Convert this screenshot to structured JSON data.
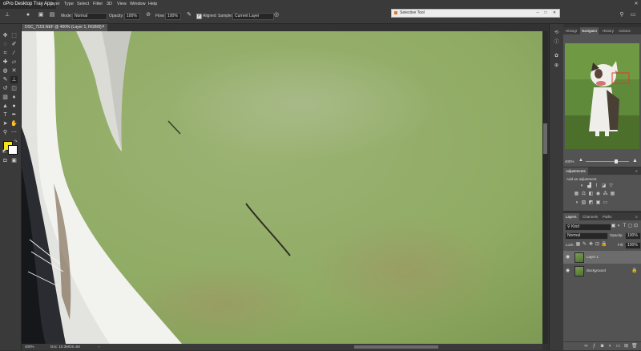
{
  "menubar": {
    "tray_title": "oPro Desktop Tray App",
    "items": [
      "ayer",
      "Type",
      "Select",
      "Filter",
      "3D",
      "View",
      "Window",
      "Help"
    ]
  },
  "options": {
    "mode_label": "Mode:",
    "mode_value": "Normal",
    "opacity_label": "Opacity:",
    "opacity_value": "100%",
    "flow_label": "Flow:",
    "flow_value": "100%",
    "aligned_label": "Aligned",
    "sample_label": "Sample:",
    "sample_value": "Current Layer"
  },
  "selective_tool": {
    "title": "Selective Tool"
  },
  "document": {
    "tab_title": "DSC_7153.NEF @ 400% (Layer 1, RGB/8) *",
    "zoom": "400%",
    "doc_info": "Doc: 10.3M/20.4M"
  },
  "navigator": {
    "tabs": [
      "Histogr",
      "Navigator",
      "History",
      "Actions"
    ],
    "active_tab": "Navigator",
    "zoom": "400%"
  },
  "adjustments": {
    "tab": "Adjustments",
    "add_label": "Add an adjustment"
  },
  "layers": {
    "tabs": [
      "Layers",
      "Channels",
      "Paths"
    ],
    "active_tab": "Layers",
    "kind_label": "Kind",
    "blend_mode": "Normal",
    "opacity_label": "Opacity:",
    "opacity_value": "100%",
    "lock_label": "Lock:",
    "fill_label": "Fill:",
    "fill_value": "100%",
    "items": [
      {
        "name": "Layer 1",
        "selected": true
      },
      {
        "name": "Background",
        "selected": false
      }
    ]
  },
  "colors": {
    "foreground": "#f4e31a",
    "background": "#ffffff"
  }
}
